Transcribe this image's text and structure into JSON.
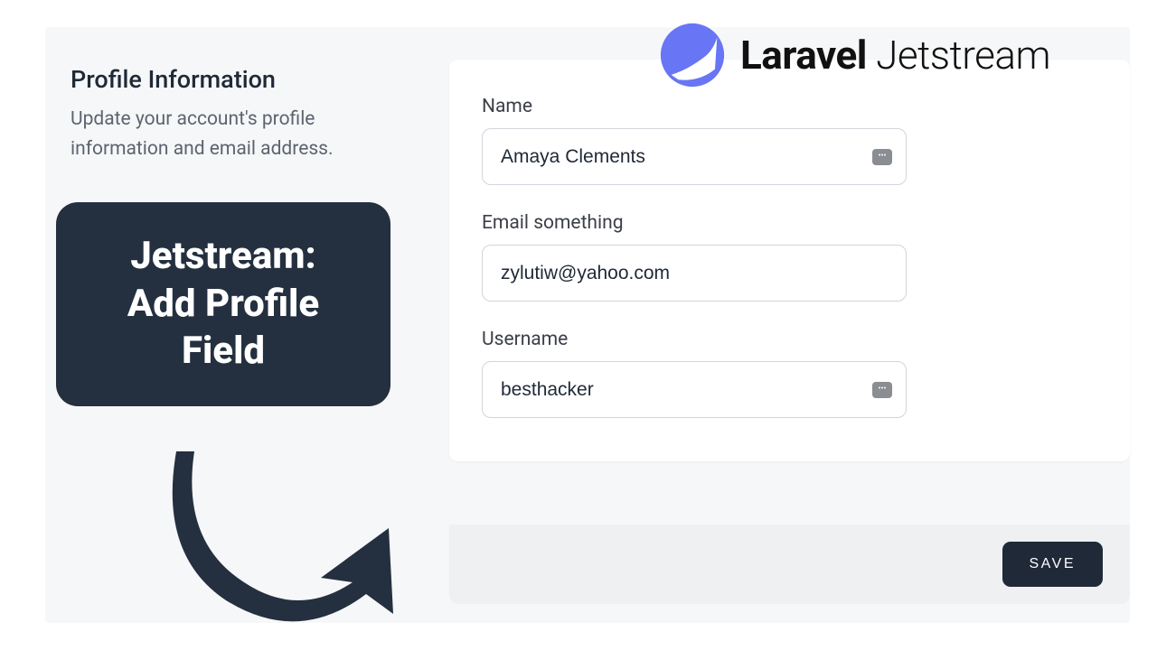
{
  "brand": {
    "bold": "Laravel",
    "light": "Jetstream"
  },
  "section": {
    "title": "Profile Information",
    "description": "Update your account's profile information and email address."
  },
  "form": {
    "name": {
      "label": "Name",
      "value": "Amaya Clements"
    },
    "email": {
      "label": "Email something",
      "value": "zylutiw@yahoo.com"
    },
    "username": {
      "label": "Username",
      "value": "besthacker"
    }
  },
  "actions": {
    "save": "SAVE"
  },
  "callout": {
    "line1": "Jetstream:",
    "line2": "Add Profile",
    "line3": "Field"
  }
}
